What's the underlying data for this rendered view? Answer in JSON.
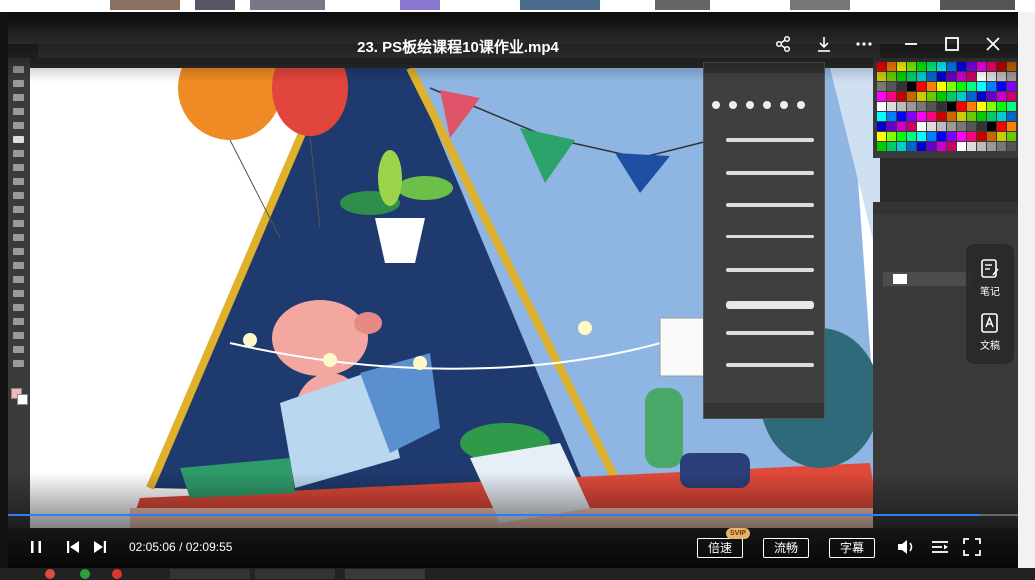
{
  "player": {
    "title": "23. PS板绘课程10课作业.mp4",
    "current_time": "02:05:06",
    "total_time": "02:09:55",
    "time_separator": "/",
    "progress": 0.963,
    "speed_label": "倍速",
    "svip_badge": "SVIP",
    "quality_label": "流畅",
    "subtitle_label": "字幕",
    "side_note_label": "笔记",
    "side_text_label": "文稿",
    "accent_color": "#2e7cf6"
  },
  "icons": {
    "share": "share-icon",
    "download": "download-icon",
    "more": "more-icon",
    "minimize": "minimize-icon",
    "maximize": "maximize-icon",
    "close": "close-icon",
    "pause": "pause-icon",
    "prev": "prev-icon",
    "next": "next-icon",
    "volume": "volume-icon",
    "playlist": "playlist-icon",
    "fullscreen": "fullscreen-icon",
    "note": "note-icon",
    "text": "text-icon"
  }
}
